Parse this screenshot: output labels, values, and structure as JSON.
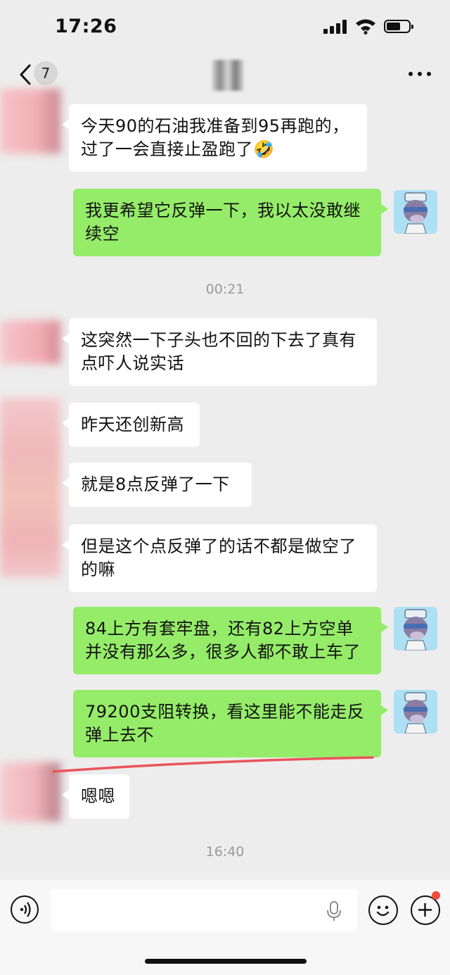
{
  "status": {
    "time": "17:26"
  },
  "nav": {
    "unread_count": "7",
    "title": "半仙"
  },
  "messages": [
    {
      "text": "今天90的石油我准备到95再跑的，过了一会直接止盈跑了🤣"
    },
    {
      "text": "我更希望它反弹一下，我以太没敢继续空"
    },
    {
      "text": "这突然一下子头也不回的下去了真有点吓人说实话"
    },
    {
      "text": "昨天还创新高"
    },
    {
      "text": "就是8点反弹了一下"
    },
    {
      "text": "但是这个点反弹了的话不都是做空了的嘛"
    },
    {
      "text": "84上方有套牢盘，还有82上方空单并没有那么多，很多人都不敢上车了"
    },
    {
      "text": "79200支阻转换，看这里能不能走反弹上去不"
    },
    {
      "text": "嗯嗯"
    }
  ],
  "timestamps": {
    "t1": "00:21",
    "t2": "16:40"
  },
  "input": {
    "placeholder": ""
  },
  "colors": {
    "sent_bubble": "#95ec69",
    "received_bubble": "#ffffff",
    "background": "#ededed",
    "annotation_line": "#e8555a"
  }
}
